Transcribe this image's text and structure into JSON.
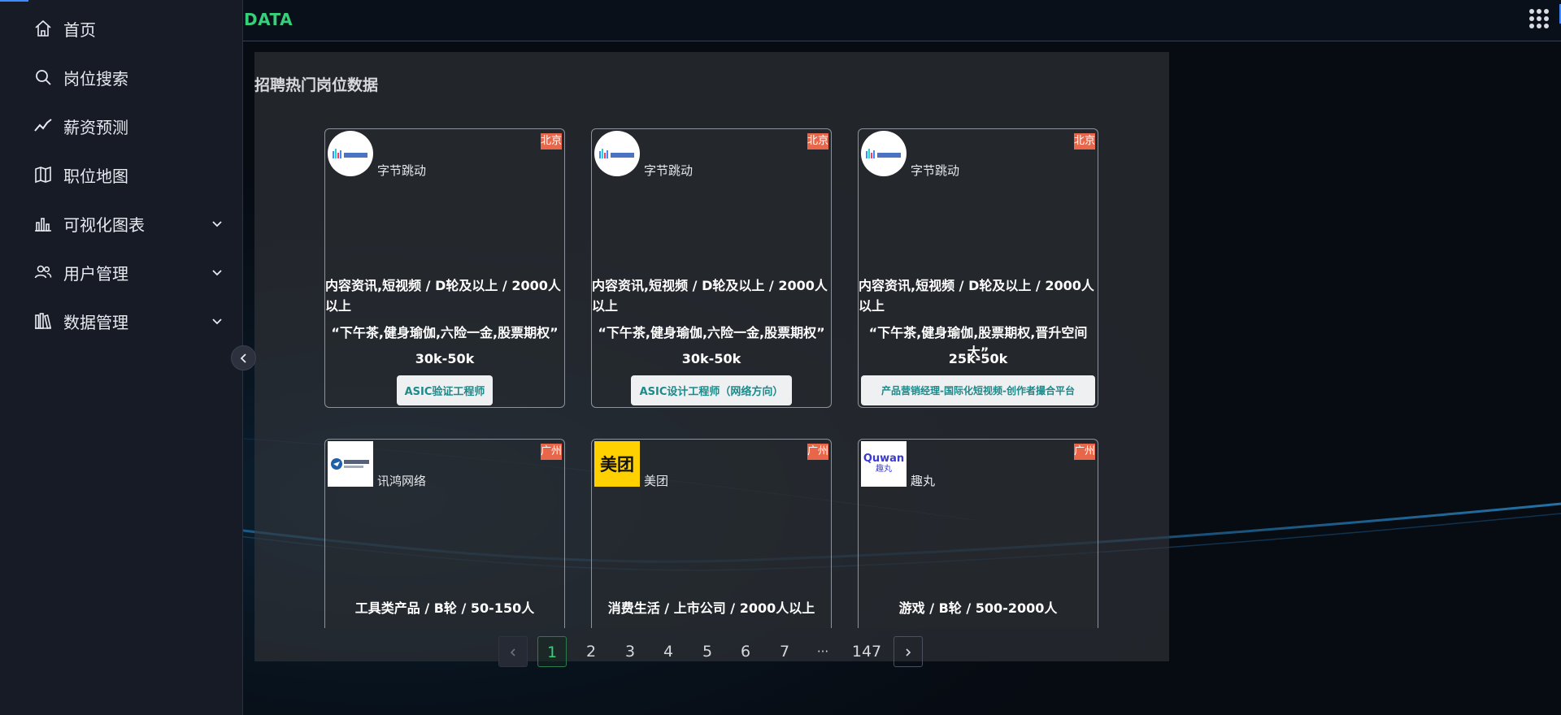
{
  "brand": "DATA",
  "sidebar": {
    "items": [
      {
        "label": "首页",
        "icon": "home-icon"
      },
      {
        "label": "岗位搜索",
        "icon": "search-icon"
      },
      {
        "label": "薪资预测",
        "icon": "trend-line-icon"
      },
      {
        "label": "职位地图",
        "icon": "map-icon"
      },
      {
        "label": "可视化图表",
        "icon": "bar-chart-icon",
        "expandable": true
      },
      {
        "label": "用户管理",
        "icon": "users-icon",
        "expandable": true
      },
      {
        "label": "数据管理",
        "icon": "library-icon",
        "expandable": true
      }
    ]
  },
  "panel": {
    "title": "招聘热门岗位数据",
    "cards": [
      {
        "company": "字节跳动",
        "logo": "bytedance-logo",
        "city": "北京",
        "info": "内容资讯,短视频 / D轮及以上 / 2000人以上",
        "welfare": "“下午茶,健身瑜伽,六险一金,股票期权”",
        "salary": "30k-50k",
        "job": "ASIC验证工程师"
      },
      {
        "company": "字节跳动",
        "logo": "bytedance-logo",
        "city": "北京",
        "info": "内容资讯,短视频 / D轮及以上 / 2000人以上",
        "welfare": "“下午茶,健身瑜伽,六险一金,股票期权”",
        "salary": "30k-50k",
        "job": "ASIC设计工程师（网络方向）"
      },
      {
        "company": "字节跳动",
        "logo": "bytedance-logo",
        "city": "北京",
        "info": "内容资讯,短视频 / D轮及以上 / 2000人以上",
        "welfare": "“下午茶,健身瑜伽,股票期权,晋升空间大”",
        "salary": "25k-50k",
        "job": "产品营销经理-国际化短视频-创作者撮合平台"
      },
      {
        "company": "讯鸿网络",
        "logo": "xunhong-logo",
        "city": "广州",
        "info": "工具类产品 / B轮 / 50-150人"
      },
      {
        "company": "美团",
        "logo": "meituan-logo",
        "logo_text": "美团",
        "city": "广州",
        "info": "消费生活 / 上市公司 / 2000人以上"
      },
      {
        "company": "趣丸",
        "logo": "quwan-logo",
        "logo_text": "Quwan",
        "logo_sub": "趣丸",
        "city": "广州",
        "info": "游戏 / B轮 / 500-2000人"
      }
    ]
  },
  "pagination": {
    "pages": [
      "1",
      "2",
      "3",
      "4",
      "5",
      "6",
      "7"
    ],
    "ellipsis": "···",
    "last": "147",
    "current": "1"
  },
  "colors": {
    "brand": "#36d07a",
    "city_badge": "#e8664a",
    "job_text": "#1a8a8a",
    "active_page": "#36d07a"
  }
}
